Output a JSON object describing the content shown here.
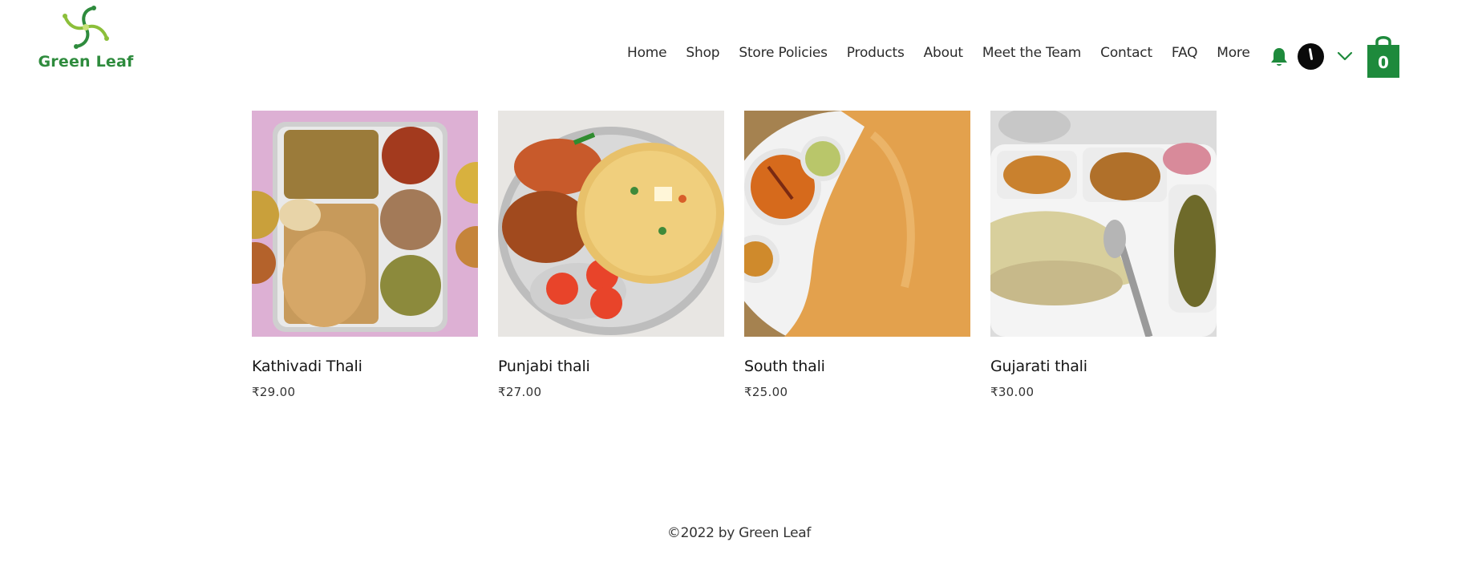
{
  "brand": {
    "name": "Green Leaf",
    "accent_color": "#1e8a3c",
    "logo_icon": "leaf-swirl-logo-icon"
  },
  "nav": {
    "items": [
      {
        "label": "Home"
      },
      {
        "label": "Shop"
      },
      {
        "label": "Store Policies"
      },
      {
        "label": "Products"
      },
      {
        "label": "About"
      },
      {
        "label": "Meet the Team"
      },
      {
        "label": "Contact"
      },
      {
        "label": "FAQ"
      },
      {
        "label": "More"
      }
    ]
  },
  "header_actions": {
    "notifications_icon": "bell-icon",
    "account_icon": "avatar",
    "account_menu_icon": "chevron-down-icon",
    "cart_icon": "shopping-bag-icon",
    "cart_count": "0"
  },
  "products": [
    {
      "name": "Kathivadi Thali",
      "price": "₹29.00",
      "image": "thali plate with rotis, rice and curries"
    },
    {
      "name": "Punjabi thali",
      "price": "₹27.00",
      "image": "paratha with dal and tomatoes"
    },
    {
      "name": "South thali",
      "price": "₹25.00",
      "image": "dosa with sambar and chutney"
    },
    {
      "name": "Gujarati thali",
      "price": "₹30.00",
      "image": "thali with khakhra and curries"
    }
  ],
  "footer": {
    "text": "©2022 by Green Leaf"
  }
}
